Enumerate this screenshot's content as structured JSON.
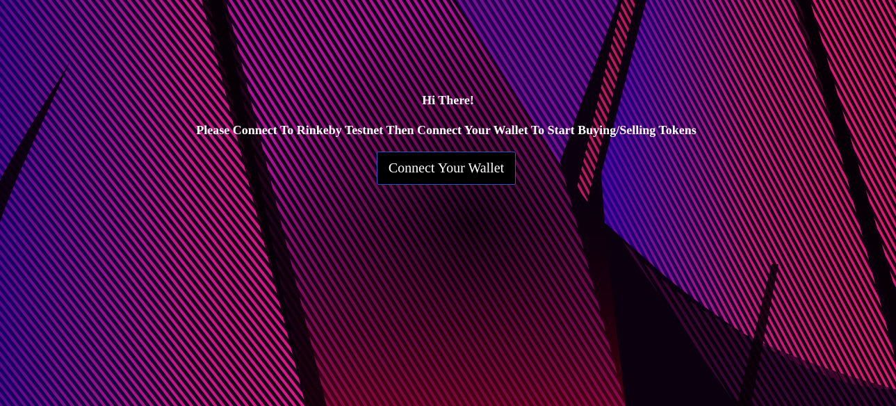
{
  "hero": {
    "greeting": "Hi There!",
    "instruction": "Please Connect To Rinkeby Testnet Then Connect Your Wallet To Start Buying/Selling Tokens"
  },
  "connect_button": {
    "label": "Connect Your Wallet"
  },
  "colors": {
    "background_pink": "#ff1493",
    "background_purple": "#3a0ca3",
    "background_dark": "#12000f",
    "button_border": "#2f55c9",
    "text": "#ffffff"
  }
}
